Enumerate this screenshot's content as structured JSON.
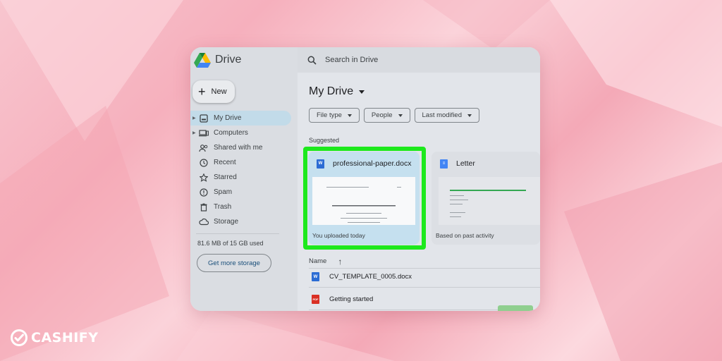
{
  "app": {
    "title": "Drive"
  },
  "new_button": {
    "label": "New"
  },
  "sidebar": {
    "items": [
      {
        "label": "My Drive",
        "icon": "my-drive-icon",
        "active": true
      },
      {
        "label": "Computers",
        "icon": "computers-icon",
        "active": false
      },
      {
        "label": "Shared with me",
        "icon": "shared-icon",
        "active": false
      },
      {
        "label": "Recent",
        "icon": "clock-icon",
        "active": false
      },
      {
        "label": "Starred",
        "icon": "star-icon",
        "active": false
      },
      {
        "label": "Spam",
        "icon": "spam-icon",
        "active": false
      },
      {
        "label": "Trash",
        "icon": "trash-icon",
        "active": false
      },
      {
        "label": "Storage",
        "icon": "cloud-icon",
        "active": false
      }
    ],
    "storage_used": "81.6 MB of 15 GB used",
    "get_storage_label": "Get more storage"
  },
  "search": {
    "placeholder": "Search in Drive"
  },
  "main": {
    "title": "My Drive",
    "filters": [
      "File type",
      "People",
      "Last modified"
    ],
    "suggested_label": "Suggested",
    "cards": [
      {
        "name": "professional-paper.docx",
        "reason": "You uploaded today",
        "icon": "word-doc-icon"
      },
      {
        "name": "Letter",
        "reason": "Based on past activity",
        "icon": "google-doc-icon"
      }
    ],
    "list_header": {
      "name": "Name"
    },
    "files": [
      {
        "name": "CV_TEMPLATE_0005.docx",
        "icon": "word-doc-icon"
      },
      {
        "name": "Getting started",
        "icon": "pdf-icon"
      }
    ]
  },
  "watermark": {
    "brand": "CASHIFY"
  },
  "colors": {
    "highlight": "#1de91d",
    "active_nav": "#c2dbe9",
    "brand_watermark": "#ffffff"
  }
}
